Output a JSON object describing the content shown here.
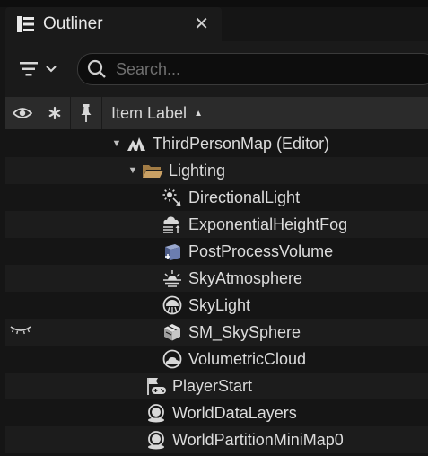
{
  "panel": {
    "title": "Outliner",
    "close_symbol": "✕"
  },
  "search": {
    "placeholder": "Search..."
  },
  "columns": {
    "item_label": "Item Label"
  },
  "tree": [
    {
      "label": "ThirdPersonMap (Editor)",
      "icon": "level-icon",
      "expanded": true
    },
    {
      "label": "Lighting",
      "icon": "folder-open-icon",
      "expanded": true
    },
    {
      "label": "DirectionalLight",
      "icon": "directional-light-icon"
    },
    {
      "label": "ExponentialHeightFog",
      "icon": "height-fog-icon"
    },
    {
      "label": "PostProcessVolume",
      "icon": "post-process-volume-icon"
    },
    {
      "label": "SkyAtmosphere",
      "icon": "sky-atmosphere-icon"
    },
    {
      "label": "SkyLight",
      "icon": "sky-light-icon"
    },
    {
      "label": "SM_SkySphere",
      "icon": "static-mesh-icon",
      "visibility": "hidden"
    },
    {
      "label": "VolumetricCloud",
      "icon": "volumetric-cloud-icon"
    },
    {
      "label": "PlayerStart",
      "icon": "player-start-icon"
    },
    {
      "label": "WorldDataLayers",
      "icon": "actor-icon"
    },
    {
      "label": "WorldPartitionMiniMap0",
      "icon": "actor-icon"
    }
  ]
}
